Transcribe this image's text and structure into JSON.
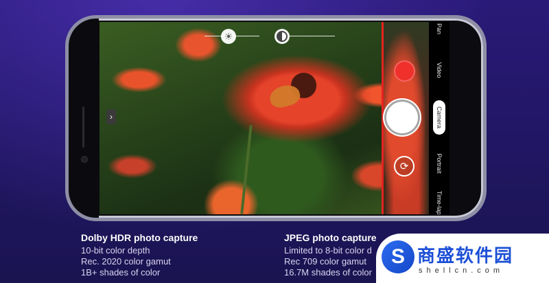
{
  "camera": {
    "modes": [
      "Pan",
      "Video",
      "Camera",
      "Portrait",
      "Time-lapse"
    ],
    "active_mode": "Camera",
    "expand_glyph": "›",
    "flip_glyph": "⟳",
    "sun_glyph": "☀"
  },
  "captions": {
    "left": {
      "title": "Dolby HDR photo capture",
      "lines": [
        "10-bit color depth",
        "Rec. 2020 color gamut",
        "1B+ shades of color"
      ]
    },
    "right": {
      "title": "JPEG photo capture",
      "lines": [
        "Limited to 8-bit color d",
        "Rec 709 color gamut",
        "16.7M shades of color"
      ]
    }
  },
  "watermark": {
    "logo_letter": "S",
    "name": "商盛软件园",
    "url": "shellcn.com"
  },
  "colors": {
    "background": "#23176a",
    "record": "#f0302b",
    "guide_line": "#e5231f",
    "watermark_blue": "#1c4fd6"
  }
}
